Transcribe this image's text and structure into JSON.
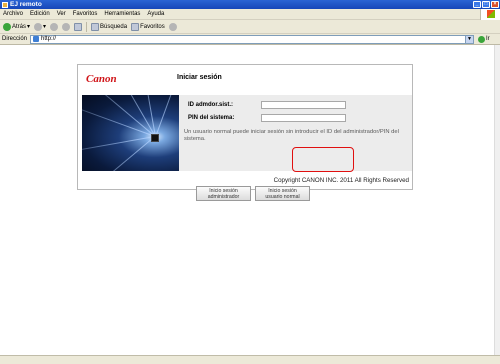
{
  "window": {
    "title": "EJ remoto"
  },
  "menu": [
    "Archivo",
    "Edición",
    "Ver",
    "Favoritos",
    "Herramientas",
    "Ayuda"
  ],
  "toolbar": {
    "back_label": "Atrás",
    "search_label": "Búsqueda",
    "favorites_label": "Favoritos"
  },
  "address": {
    "label": "Dirección",
    "url": "http://",
    "go_label": "Ir"
  },
  "login": {
    "brand": "Canon",
    "title": "Iniciar sesión",
    "admin_id_label": "ID admdor.sist.:",
    "pin_label": "PIN del sistema:",
    "info_text": "Un usuario normal puede iniciar sesión sin introducir el ID del administrador/PIN del sistema.",
    "admin_button": [
      "Inicio sesión",
      "administrador"
    ],
    "user_button": [
      "Inicio sesión",
      "usuario normal"
    ],
    "copyright": "Copyright CANON INC. 2011 All Rights Reserved"
  }
}
